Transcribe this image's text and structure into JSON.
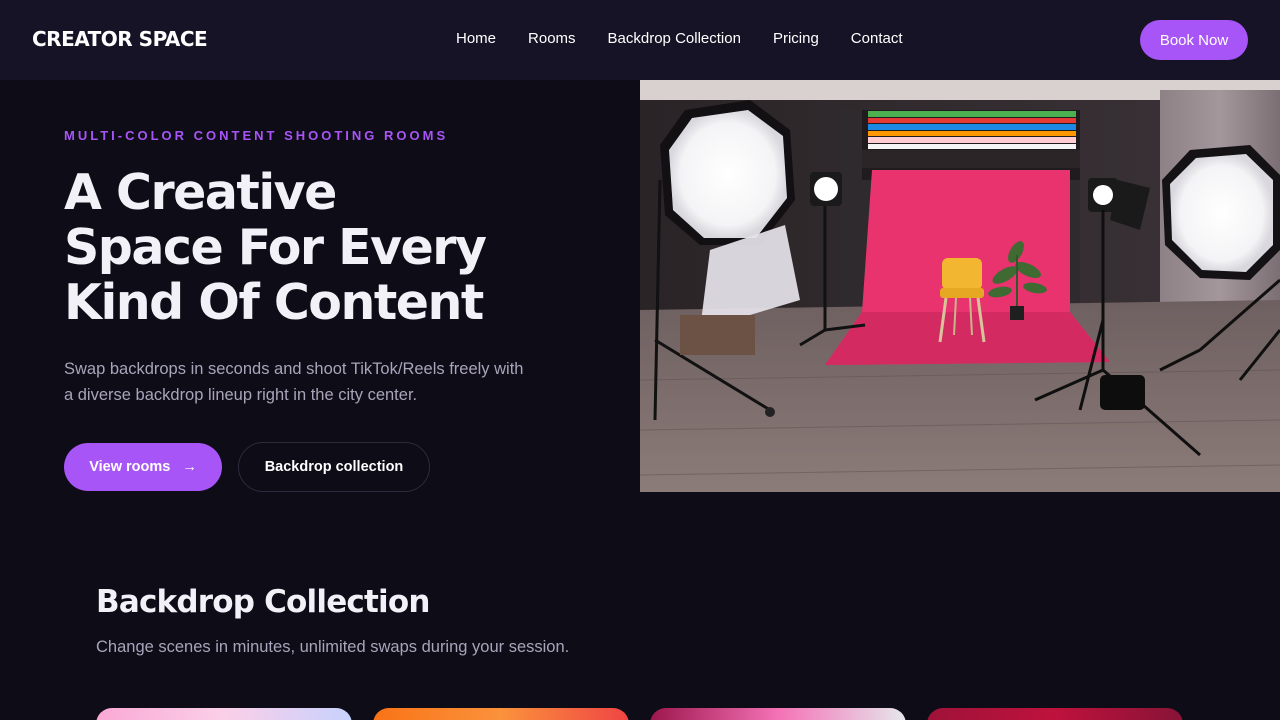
{
  "nav": {
    "logo": "CREATOR SPACE",
    "links": [
      "Home",
      "Rooms",
      "Backdrop Collection",
      "Pricing",
      "Contact"
    ],
    "cta": "Book Now"
  },
  "hero": {
    "eyebrow": "MULTI-COLOR CONTENT SHOOTING ROOMS",
    "title_lines": [
      "A Creative",
      "Space For Every",
      "Kind Of Content"
    ],
    "subtitle": "Swap backdrops in seconds and shoot TikTok/Reels freely with a diverse backdrop lineup right in the city center.",
    "primary_button": "View rooms",
    "primary_arrow": "→",
    "secondary_button": "Backdrop collection"
  },
  "collection": {
    "title": "Backdrop Collection",
    "subtitle": "Change scenes in minutes, unlimited swaps during your session."
  },
  "colors": {
    "background": "#0e0c17",
    "nav_background": "#161326",
    "accent": "#a855f7",
    "muted_text": "#a9a4ba",
    "backdrop_pink": "#e8336e"
  }
}
